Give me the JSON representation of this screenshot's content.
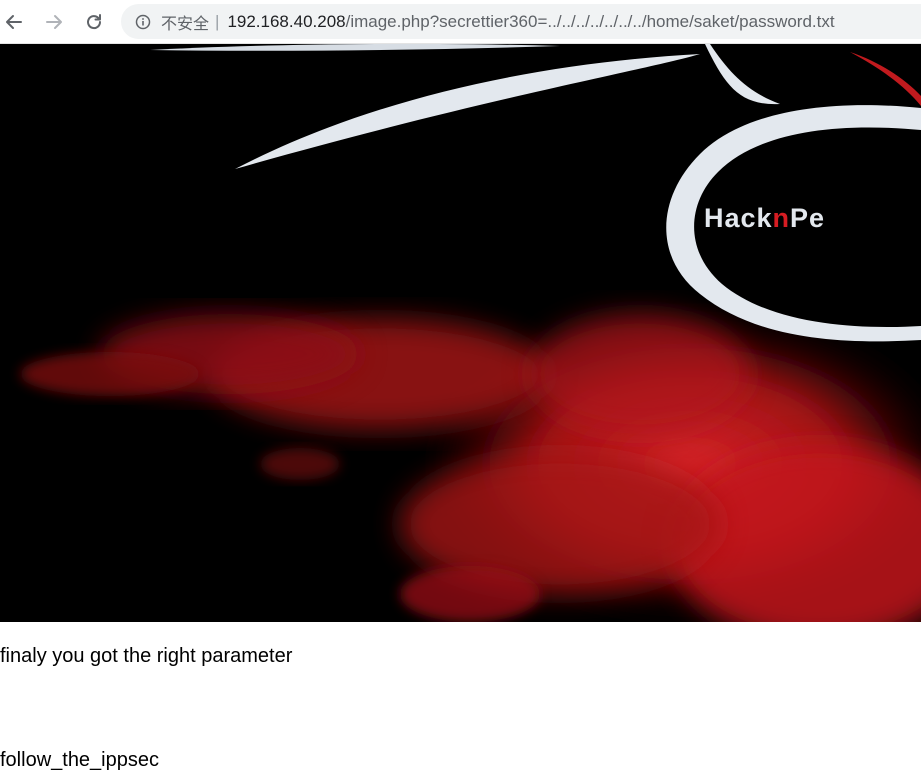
{
  "browser": {
    "security_label": "不安全",
    "separator": "|",
    "url_host": "192.168.40.208",
    "url_path": "/image.php?secrettier360=../../../../../../../home/saket/password.txt",
    "back_icon": "arrow-left-icon",
    "forward_icon": "arrow-right-icon",
    "reload_icon": "reload-icon",
    "info_icon": "info-circle-icon"
  },
  "hero": {
    "logo_part_1": "Hack",
    "logo_part_2": "n",
    "logo_part_3": "Pe",
    "colors": {
      "background": "#000000",
      "smoke": "#c0181c",
      "logo_white": "#e3e8ee",
      "logo_red": "#d61c22"
    }
  },
  "content": {
    "line1": "finaly you got the right parameter",
    "line2": "follow_the_ippsec"
  }
}
